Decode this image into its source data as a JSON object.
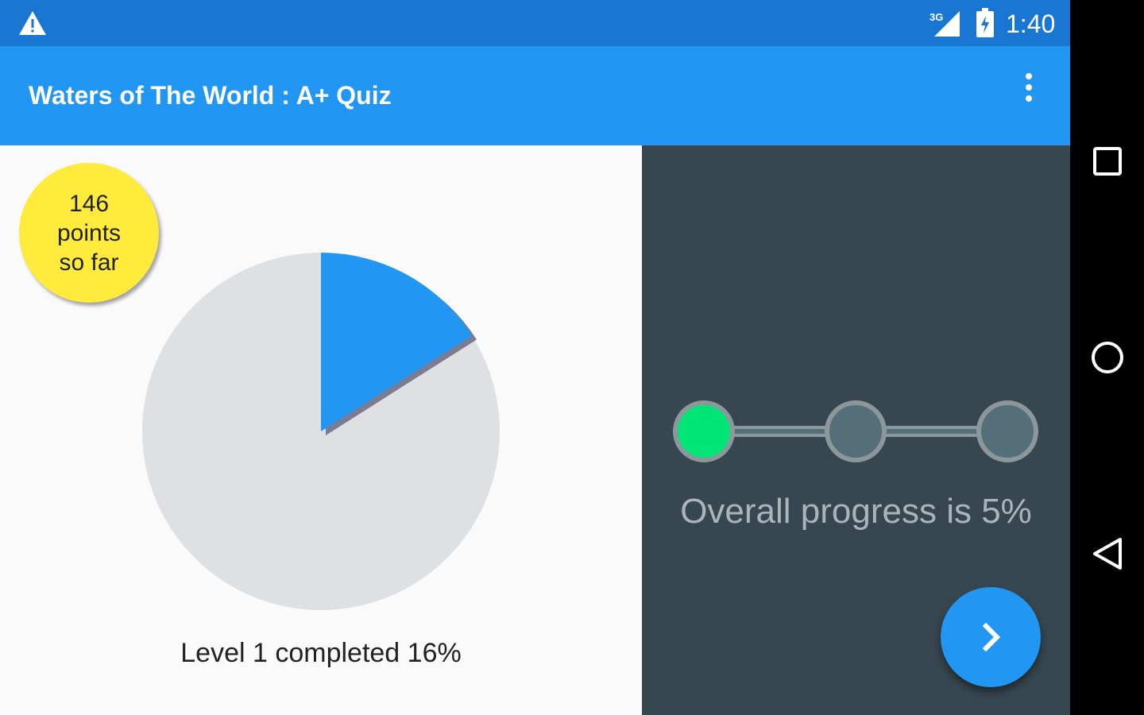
{
  "status_bar": {
    "time": "1:40",
    "network_label": "3G",
    "icons": [
      "warning-icon",
      "signal-icon",
      "battery-charging-icon"
    ]
  },
  "app_bar": {
    "title": "Waters of The World : A+ Quiz",
    "menu_icon": "more-vert-icon"
  },
  "score": {
    "points_value": "146",
    "points_label": "points",
    "points_suffix": "so far"
  },
  "level": {
    "caption": "Level 1 completed 16%",
    "completed_fraction": 0.16
  },
  "overall": {
    "caption": "Overall progress is 5%",
    "steps": [
      {
        "state": "active"
      },
      {
        "state": "inactive"
      },
      {
        "state": "inactive"
      }
    ]
  },
  "fab": {
    "icon": "chevron-right-icon"
  },
  "nav_bar": {
    "icons": [
      "recents-icon",
      "home-icon",
      "back-icon"
    ]
  },
  "colors": {
    "status_bar": "#1976d2",
    "app_bar": "#2196f3",
    "points_bubble": "#ffeb3b",
    "pie_completed": "#2196f3",
    "pie_remaining": "#dfe0e2",
    "right_panel": "#37474f",
    "step_active": "#00e676",
    "step_inactive": "#546e7a"
  }
}
